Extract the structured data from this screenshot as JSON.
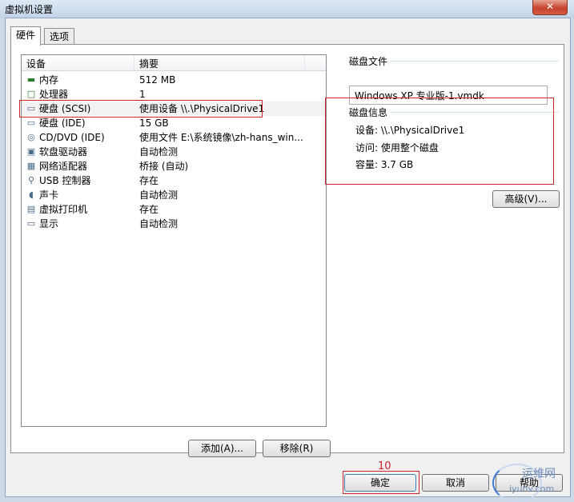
{
  "window": {
    "title": "虚拟机设置",
    "close_label": "✕"
  },
  "tabs": [
    {
      "label": "硬件"
    },
    {
      "label": "选项"
    }
  ],
  "device_list": {
    "headers": {
      "device": "设备",
      "summary": "摘要"
    },
    "rows": [
      {
        "name": "内存",
        "summary": "512 MB",
        "icon": "memory-icon"
      },
      {
        "name": "处理器",
        "summary": "1",
        "icon": "processor-icon"
      },
      {
        "name": "硬盘 (SCSI)",
        "summary": "使用设备 \\\\.\\PhysicalDrive1",
        "icon": "hard-disk-icon",
        "selected": true
      },
      {
        "name": "硬盘 (IDE)",
        "summary": "15 GB",
        "icon": "hard-disk-icon"
      },
      {
        "name": "CD/DVD (IDE)",
        "summary": "使用文件 E:\\系统镜像\\zh-hans_win...",
        "icon": "cd-dvd-icon"
      },
      {
        "name": "软盘驱动器",
        "summary": "自动检测",
        "icon": "floppy-icon"
      },
      {
        "name": "网络适配器",
        "summary": "桥接 (自动)",
        "icon": "network-adapter-icon"
      },
      {
        "name": "USB 控制器",
        "summary": "存在",
        "icon": "usb-icon"
      },
      {
        "name": "声卡",
        "summary": "自动检测",
        "icon": "sound-card-icon"
      },
      {
        "name": "虚拟打印机",
        "summary": "存在",
        "icon": "printer-icon"
      },
      {
        "name": "显示",
        "summary": "自动检测",
        "icon": "display-icon"
      }
    ]
  },
  "disk_file": {
    "label": "磁盘文件",
    "value": "Windows XP 专业版-1.vmdk"
  },
  "disk_info": {
    "label": "磁盘信息",
    "device": "设备: \\\\.\\PhysicalDrive1",
    "access": "访问: 使用整个磁盘",
    "capacity": "容量: 3.7 GB"
  },
  "buttons": {
    "advanced": "高级(V)...",
    "add": "添加(A)...",
    "remove": "移除(R)",
    "ok": "确定",
    "cancel": "取消",
    "help": "帮助"
  },
  "annotation": {
    "number": "10"
  },
  "watermark": {
    "text_cn": "运维网",
    "text_en": "iyunv.com"
  },
  "colors": {
    "annotation_red": "#d0232b"
  }
}
